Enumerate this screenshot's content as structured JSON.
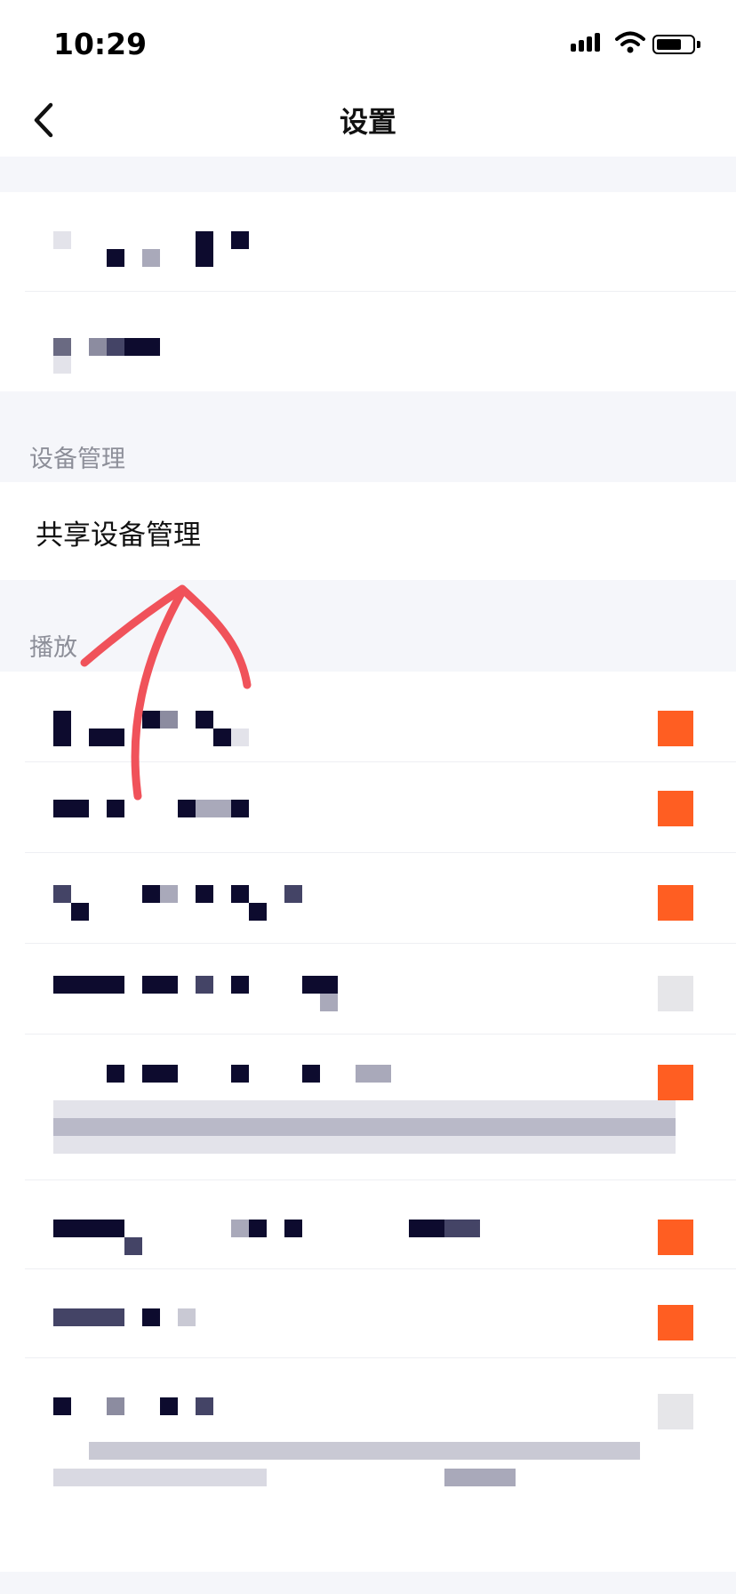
{
  "status_bar": {
    "time": "10:29"
  },
  "nav": {
    "title": "设置"
  },
  "sections": {
    "device_management": {
      "header": "设备管理",
      "items": [
        {
          "label": "共享设备管理"
        }
      ]
    },
    "playback": {
      "header": "播放"
    }
  },
  "colors": {
    "accent": "#ff5e22",
    "annotation_arrow": "#f0525a",
    "section_background": "#f5f6fa",
    "pixelated_dark": "#0d0b2e",
    "pixelated_mid": "#444466",
    "pixelated_light": "#c9c9d4"
  },
  "icons": {
    "back": "chevron-left-icon"
  }
}
